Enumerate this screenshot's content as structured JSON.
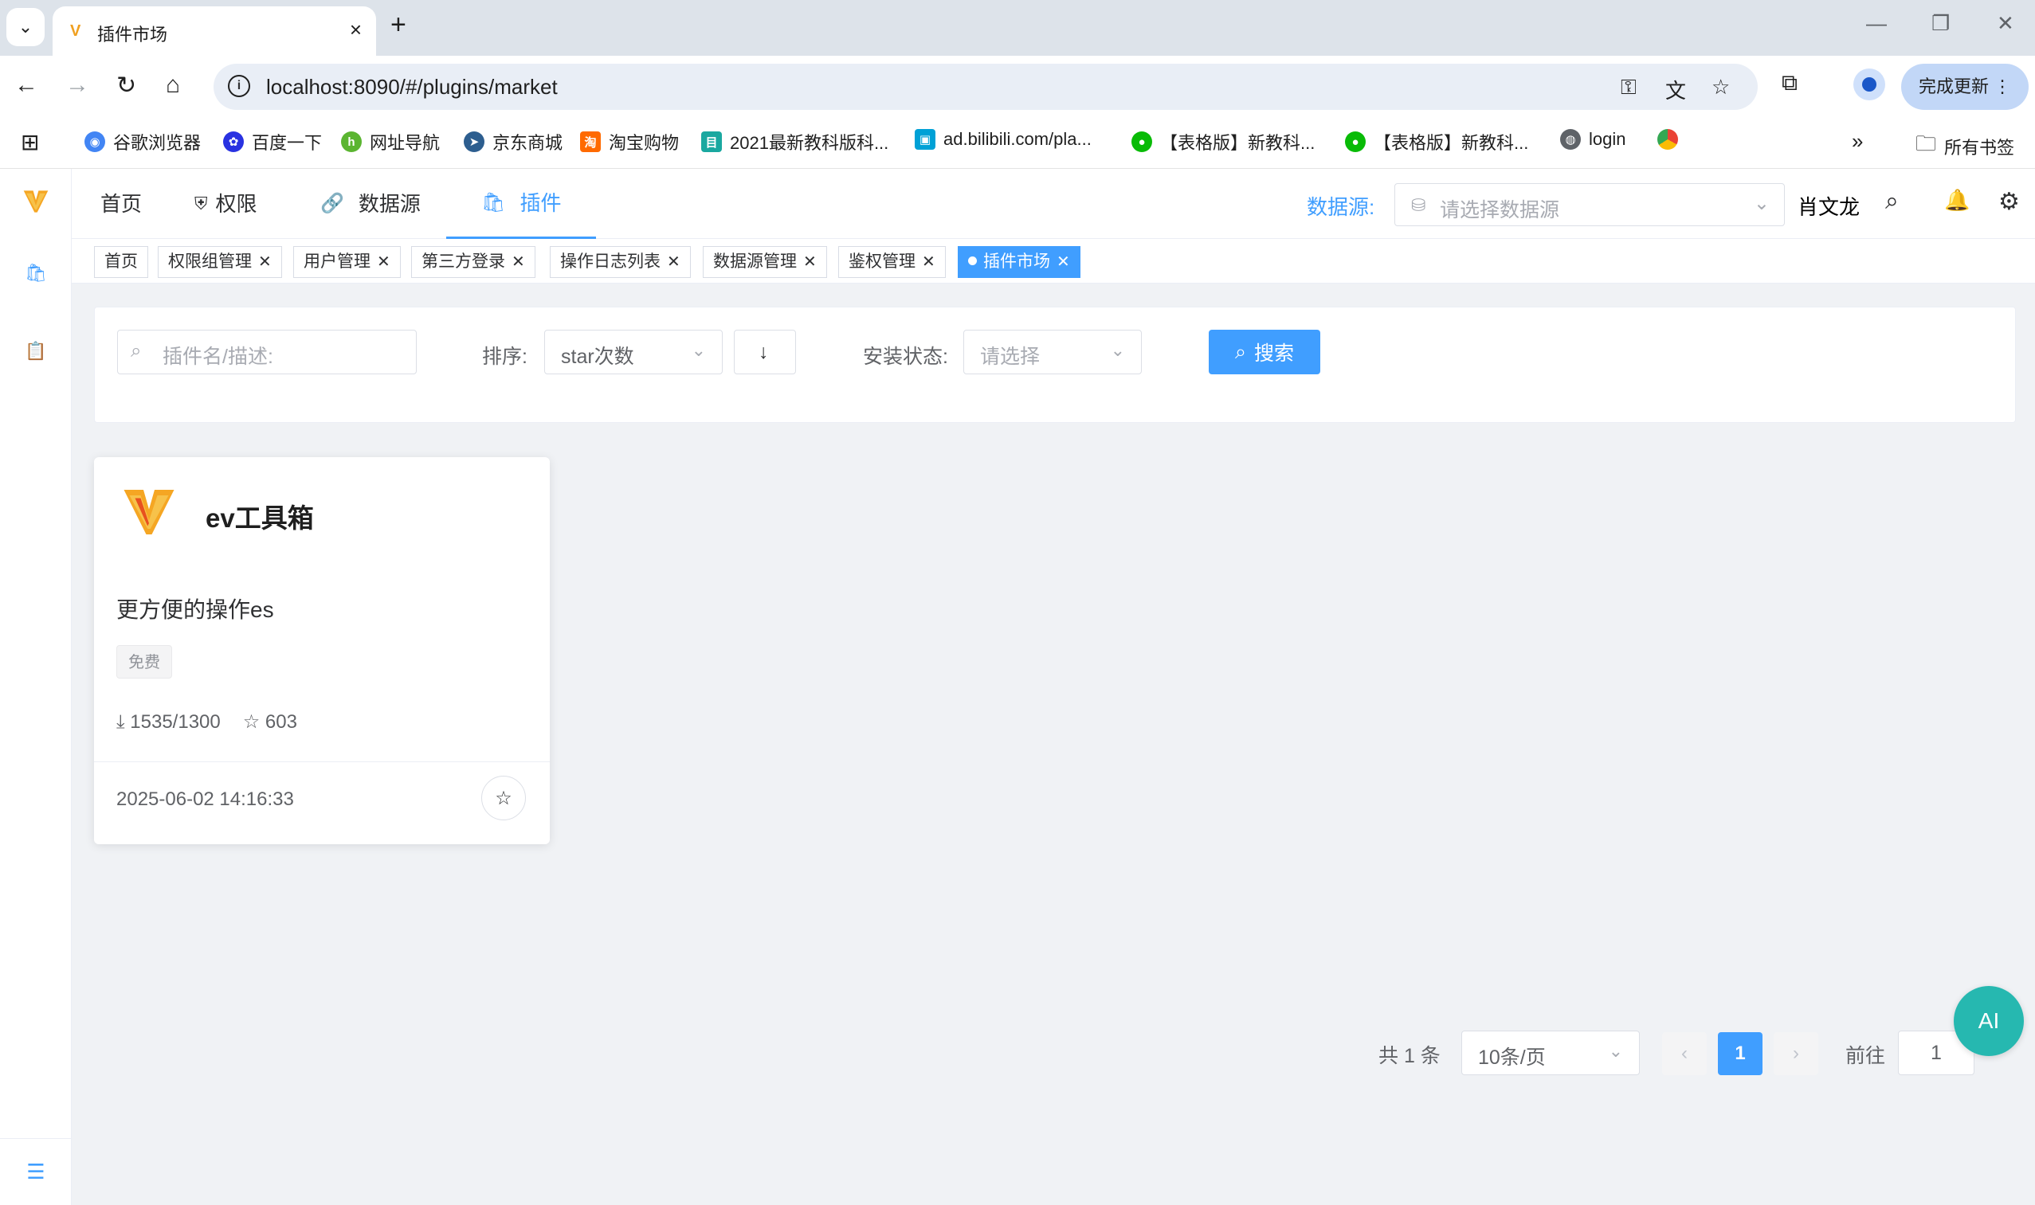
{
  "browser": {
    "tab_title": "插件市场",
    "url": "localhost:8090/#/plugins/market",
    "update_label": "完成更新",
    "bookmarks": [
      {
        "label": "谷歌浏览器",
        "color": "#4285f4"
      },
      {
        "label": "百度一下",
        "color": "#2932e1"
      },
      {
        "label": "网址导航",
        "color": "#5bb531"
      },
      {
        "label": "京东商城",
        "color": "#2d5e8f"
      },
      {
        "label": "淘宝购物",
        "color": "#ff6a00"
      },
      {
        "label": "2021最新教科版科...",
        "color": "#1aa8a0"
      },
      {
        "label": "ad.bilibili.com/pla...",
        "color": "#00a1d6"
      },
      {
        "label": "【表格版】新教科...",
        "color": "#09bb07"
      },
      {
        "label": "【表格版】新教科...",
        "color": "#09bb07"
      },
      {
        "label": "login",
        "color": "#5f6368"
      }
    ],
    "all_bookmarks": "所有书签"
  },
  "topnav": {
    "items": [
      {
        "label": "首页",
        "icon": ""
      },
      {
        "label": "权限",
        "icon": "shield-icon"
      },
      {
        "label": "数据源",
        "icon": "link-icon"
      },
      {
        "label": "插件",
        "icon": "bag-icon"
      }
    ],
    "datasource_label": "数据源:",
    "datasource_placeholder": "请选择数据源",
    "user_name": "肖文龙"
  },
  "tags": [
    {
      "label": "首页",
      "closable": false
    },
    {
      "label": "权限组管理",
      "closable": true
    },
    {
      "label": "用户管理",
      "closable": true
    },
    {
      "label": "第三方登录",
      "closable": true
    },
    {
      "label": "操作日志列表",
      "closable": true
    },
    {
      "label": "数据源管理",
      "closable": true
    },
    {
      "label": "鉴权管理",
      "closable": true
    },
    {
      "label": "插件市场",
      "closable": true,
      "active": true
    }
  ],
  "filter": {
    "search_placeholder": "插件名/描述:",
    "sort_label": "排序:",
    "sort_value": "star次数",
    "order_symbol": "↓",
    "status_label": "安装状态:",
    "status_placeholder": "请选择",
    "search_button": "搜索"
  },
  "plugins": [
    {
      "name": "ev工具箱",
      "description": "更方便的操作es",
      "tag": "免费",
      "downloads": "1535/1300",
      "stars": "603",
      "date": "2025-06-02 14:16:33"
    }
  ],
  "pagination": {
    "total": "共 1 条",
    "page_size": "10条/页",
    "current_page": "1",
    "goto_label": "前往",
    "goto_value": "1"
  },
  "ai_button": "AI",
  "colors": {
    "primary": "#409eff",
    "ai": "#26b8b0"
  }
}
